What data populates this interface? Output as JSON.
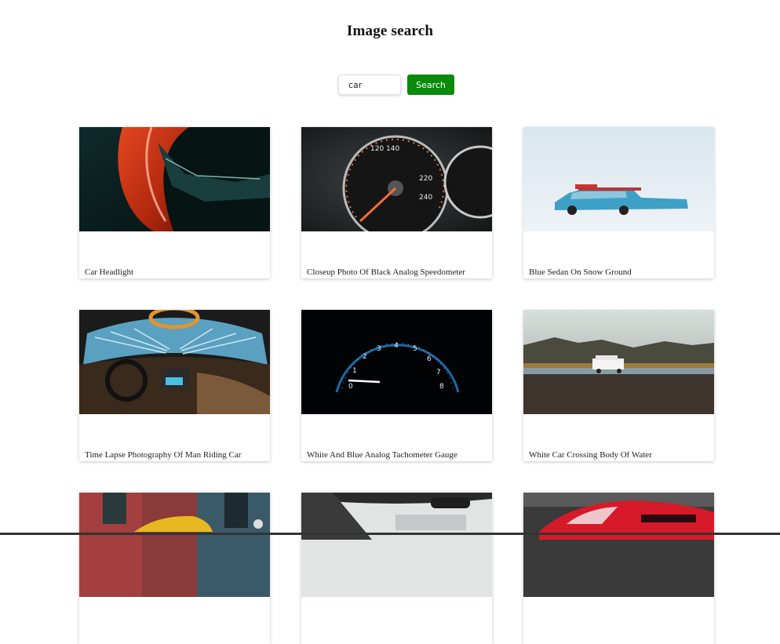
{
  "page": {
    "title": "Image search"
  },
  "search": {
    "value": "car",
    "button_label": "Search"
  },
  "results": [
    {
      "caption": "Car Headlight",
      "image": "red-car-headlight"
    },
    {
      "caption": "Closeup Photo Of Black Analog Speedometer",
      "image": "speedometer"
    },
    {
      "caption": "Blue Sedan On Snow Ground",
      "image": "blue-car-snow"
    },
    {
      "caption": "Time Lapse Photography Of Man Riding Car",
      "image": "car-interior-timelapse"
    },
    {
      "caption": "White And Blue Analog Tachometer Gauge",
      "image": "tachometer"
    },
    {
      "caption": "White Car Crossing Body Of Water",
      "image": "white-suv-water"
    },
    {
      "caption": "",
      "image": "yellow-taxi-street"
    },
    {
      "caption": "",
      "image": "car-dashboard-mirror"
    },
    {
      "caption": "",
      "image": "red-sports-car"
    }
  ]
}
